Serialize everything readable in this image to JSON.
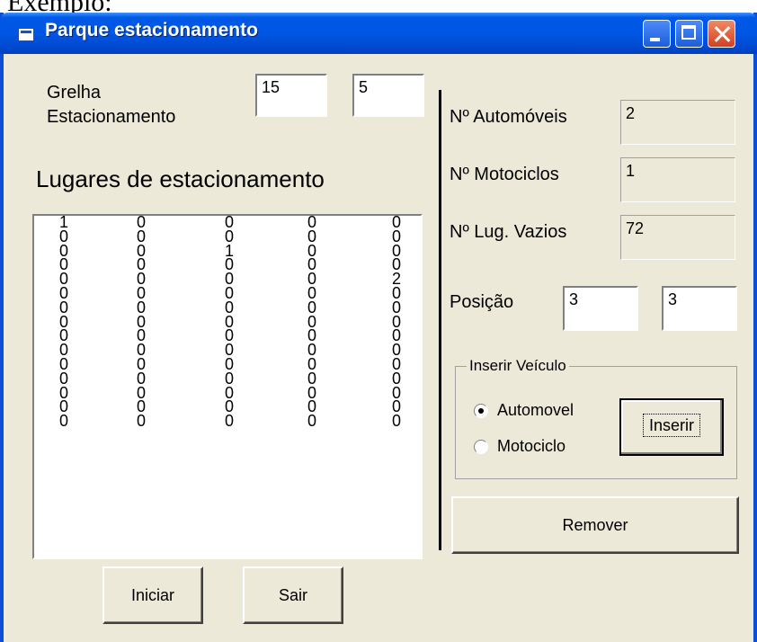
{
  "doc_header": "Exemplo:",
  "window": {
    "title": "Parque estacionamento",
    "icon": "app-window-icon"
  },
  "grid": {
    "label_line1": "Grelha",
    "label_line2": "Estacionamento",
    "rows": "15",
    "cols": "5"
  },
  "parking": {
    "heading": "Lugares de estacionamento",
    "rows": [
      [
        "1",
        "0",
        "0",
        "0",
        "0"
      ],
      [
        "0",
        "0",
        "0",
        "0",
        "0"
      ],
      [
        "0",
        "0",
        "1",
        "0",
        "0"
      ],
      [
        "0",
        "0",
        "0",
        "0",
        "0"
      ],
      [
        "0",
        "0",
        "0",
        "0",
        "2"
      ],
      [
        "0",
        "0",
        "0",
        "0",
        "0"
      ],
      [
        "0",
        "0",
        "0",
        "0",
        "0"
      ],
      [
        "0",
        "0",
        "0",
        "0",
        "0"
      ],
      [
        "0",
        "0",
        "0",
        "0",
        "0"
      ],
      [
        "0",
        "0",
        "0",
        "0",
        "0"
      ],
      [
        "0",
        "0",
        "0",
        "0",
        "0"
      ],
      [
        "0",
        "0",
        "0",
        "0",
        "0"
      ],
      [
        "0",
        "0",
        "0",
        "0",
        "0"
      ],
      [
        "0",
        "0",
        "0",
        "0",
        "0"
      ],
      [
        "0",
        "0",
        "0",
        "0",
        "0"
      ]
    ]
  },
  "stats": {
    "cars_label": "Nº Automóveis",
    "cars_value": "2",
    "motos_label": "Nº Motociclos",
    "motos_value": "1",
    "empty_label": "Nº Lug. Vazios",
    "empty_value": "72"
  },
  "position": {
    "label": "Posição",
    "row": "3",
    "col": "3"
  },
  "insert_vehicle": {
    "title": "Inserir Veículo",
    "options": [
      {
        "label": "Automovel",
        "selected": true
      },
      {
        "label": "Motociclo",
        "selected": false
      }
    ],
    "insert_label": "Inserir"
  },
  "buttons": {
    "remove": "Remover",
    "start": "Iniciar",
    "exit": "Sair"
  }
}
